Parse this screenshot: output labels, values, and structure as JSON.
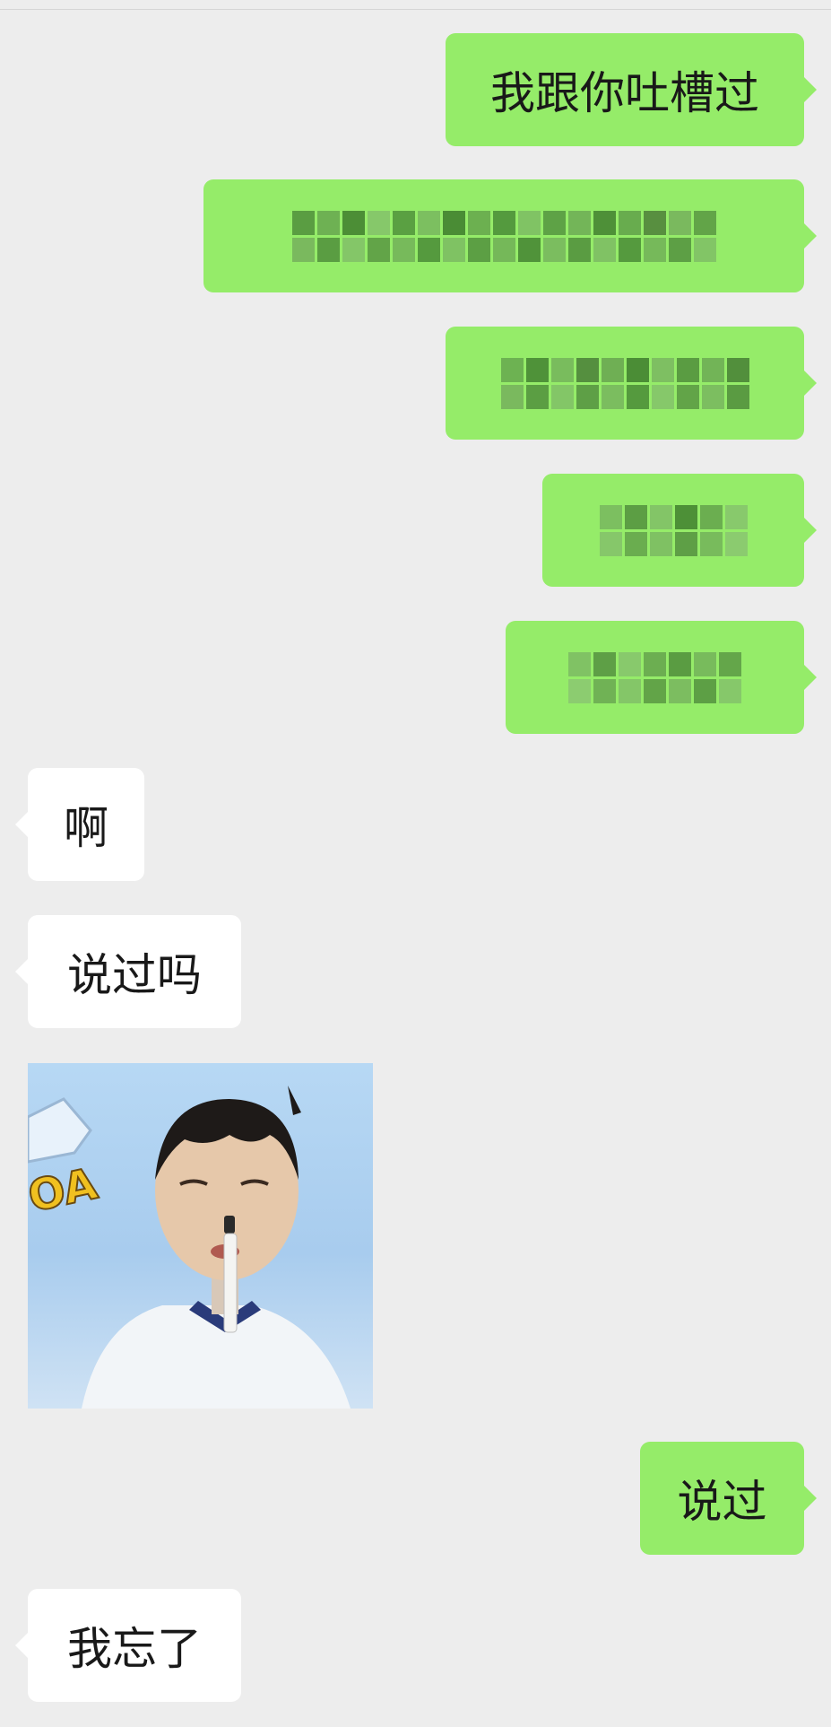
{
  "colors": {
    "background": "#ededed",
    "sent_bubble": "#95ec69",
    "received_bubble": "#ffffff",
    "text": "#191919"
  },
  "messages": [
    {
      "side": "right",
      "text": "我跟你吐槽过"
    },
    {
      "side": "right",
      "text": ""
    },
    {
      "side": "right",
      "text": ""
    },
    {
      "side": "right",
      "text": ""
    },
    {
      "side": "right",
      "text": ""
    },
    {
      "side": "left",
      "text": "啊"
    },
    {
      "side": "left",
      "text": "说过吗"
    },
    {
      "side": "left",
      "type": "sticker",
      "icon": "meme-sticker"
    },
    {
      "side": "right",
      "text": "说过"
    },
    {
      "side": "left",
      "text": "我忘了"
    }
  ]
}
